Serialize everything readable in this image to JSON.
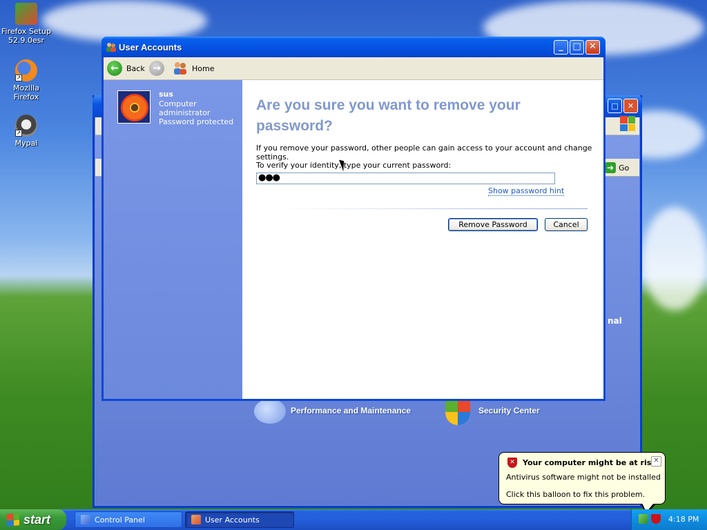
{
  "desktop": {
    "icons": [
      {
        "label": "Firefox Setup 52.9.0esr",
        "icon": "installer-icon"
      },
      {
        "label": "Mozilla Firefox",
        "icon": "firefox-icon"
      },
      {
        "label": "Mypal",
        "icon": "mypal-icon"
      }
    ]
  },
  "control_panel": {
    "go_label": "Go",
    "partial_label": "nal",
    "categories": [
      "Performance and Maintenance",
      "Security Center"
    ]
  },
  "window": {
    "title": "User Accounts",
    "toolbar": {
      "back_label": "Back",
      "home_label": "Home"
    },
    "sidebar": {
      "user_name": "sus",
      "user_role_line1": "Computer",
      "user_role_line2": "administrator",
      "user_status": "Password protected"
    },
    "content": {
      "heading": "Are you sure you want to remove your password?",
      "explanation": "If you remove your password, other people can gain access to your account and change settings.",
      "verify_label": "To verify your identity, type your current password:",
      "password_value": "●●●",
      "hint_link": "Show password hint",
      "remove_button": "Remove Password",
      "cancel_button": "Cancel"
    }
  },
  "taskbar": {
    "start_label": "start",
    "tasks": [
      {
        "label": "Control Panel",
        "active": false
      },
      {
        "label": "User Accounts",
        "active": true
      }
    ],
    "clock": "4:18 PM"
  },
  "balloon": {
    "title": "Your computer might be at risk",
    "line1": "Antivirus software might not be installed",
    "line2": "Click this balloon to fix this problem."
  },
  "colors": {
    "heading": "#8198cf",
    "titlebar": "#0654e3",
    "sidebar": "#7a96e6",
    "link": "#1c58c9",
    "balloon_bg": "#ffffe1"
  }
}
